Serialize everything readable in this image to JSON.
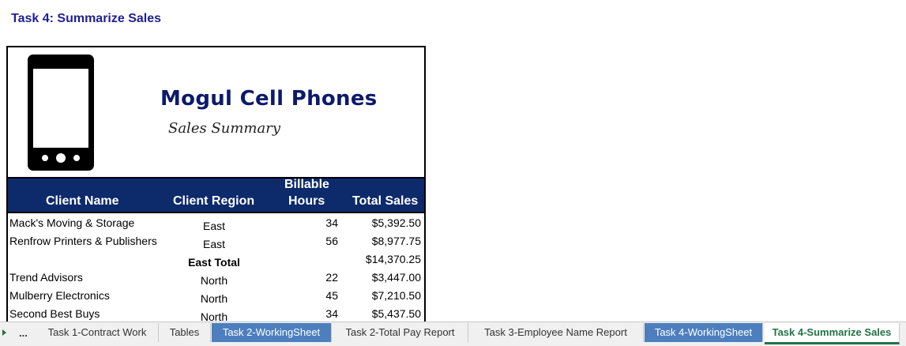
{
  "task_title": "Task 4: Summarize Sales",
  "report": {
    "company": "Mogul Cell Phones",
    "subtitle": "Sales Summary",
    "columns": {
      "client_name": "Client Name",
      "client_region": "Client Region",
      "billable_line1": "Billable",
      "billable_line2": "Hours",
      "total_sales": "Total Sales"
    },
    "rows": [
      {
        "client": "Mack's Moving & Storage",
        "region": "East",
        "hours": "34",
        "sales": "$5,392.50"
      },
      {
        "client": "Renfrow Printers & Publishers",
        "region": "East",
        "hours": "56",
        "sales": "$8,977.75"
      },
      {
        "client": "",
        "region": "East Total",
        "hours": "",
        "sales": "$14,370.25"
      },
      {
        "client": "Trend Advisors",
        "region": "North",
        "hours": "22",
        "sales": "$3,447.00"
      },
      {
        "client": "Mulberry Electronics",
        "region": "North",
        "hours": "45",
        "sales": "$7,210.50"
      },
      {
        "client": "Second Best Buys",
        "region": "North",
        "hours": "34",
        "sales": "$5,437.50"
      }
    ]
  },
  "tabs": {
    "overflow": "...",
    "items": [
      {
        "label": "Task 1-Contract Work"
      },
      {
        "label": "Tables"
      },
      {
        "label": "Task 2-WorkingSheet"
      },
      {
        "label": "Task 2-Total Pay Report"
      },
      {
        "label": "Task 3-Employee Name Report"
      },
      {
        "label": "Task 4-WorkingSheet"
      },
      {
        "label": "Task 4-Summarize Sales"
      }
    ]
  },
  "colors": {
    "header_bg": "#0d2a6b",
    "title_blue": "#1f1f8f",
    "tab_blue": "#4d7fbf",
    "excel_green": "#217346"
  }
}
